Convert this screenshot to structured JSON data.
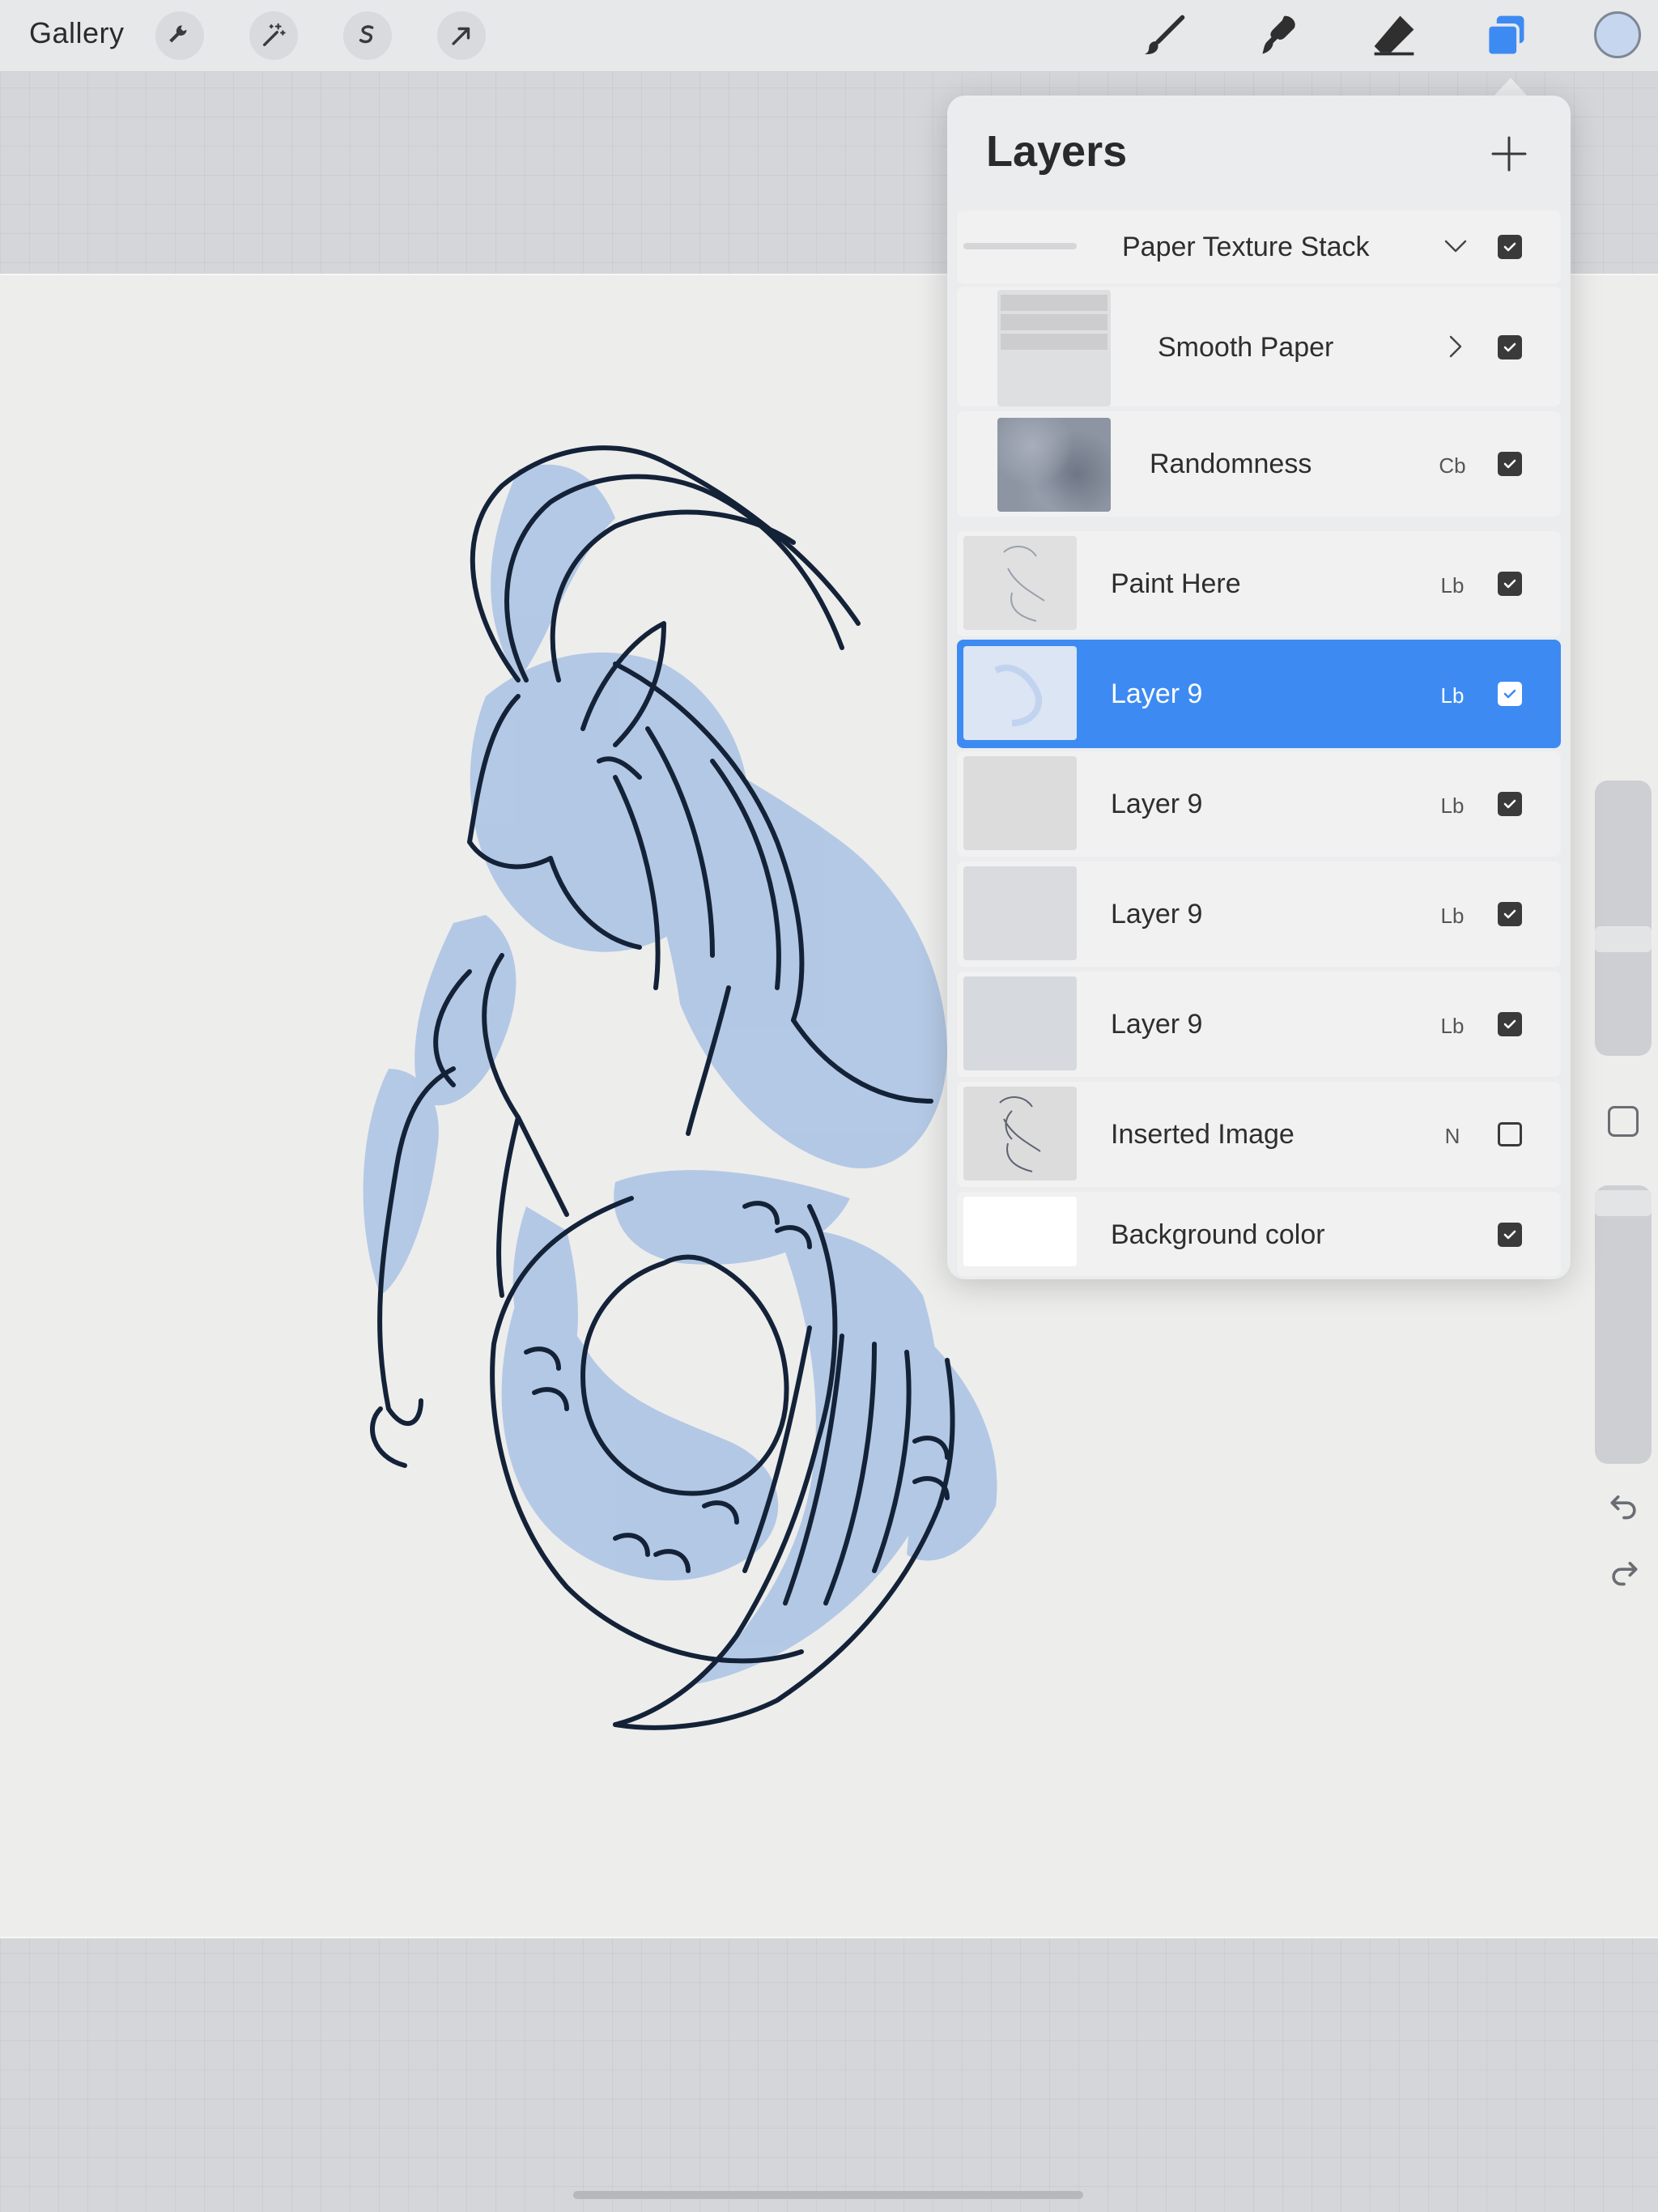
{
  "toolbar": {
    "gallery_label": "Gallery",
    "left_tools": [
      "wrench-icon",
      "magic-wand-icon",
      "selection-icon",
      "transform-arrow-icon"
    ],
    "right_tools": [
      "brush-icon",
      "smudge-icon",
      "eraser-icon",
      "layers-icon"
    ],
    "active_tool": "layers-icon",
    "color_swatch": "#c6d6ee"
  },
  "layers_panel": {
    "title": "Layers",
    "add_icon": "plus-icon",
    "rows": [
      {
        "name": "Paper Texture Stack",
        "blend": "",
        "visible": true,
        "type": "group-expanded"
      },
      {
        "name": "Smooth Paper",
        "blend": "",
        "visible": true,
        "type": "group-collapsed"
      },
      {
        "name": "Randomness",
        "blend": "Cb",
        "visible": true,
        "type": "layer"
      },
      {
        "name": "Paint Here",
        "blend": "Lb",
        "visible": true,
        "type": "layer"
      },
      {
        "name": "Layer 9",
        "blend": "Lb",
        "visible": true,
        "type": "layer",
        "selected": true
      },
      {
        "name": "Layer 9",
        "blend": "Lb",
        "visible": true,
        "type": "layer"
      },
      {
        "name": "Layer 9",
        "blend": "Lb",
        "visible": true,
        "type": "layer"
      },
      {
        "name": "Layer 9",
        "blend": "Lb",
        "visible": true,
        "type": "layer"
      },
      {
        "name": "Inserted Image",
        "blend": "N",
        "visible": false,
        "type": "layer"
      },
      {
        "name": "Background color",
        "blend": "",
        "visible": true,
        "type": "background"
      }
    ]
  },
  "colors": {
    "accent": "#3d8bf2",
    "ink": "#142238",
    "wash": "#a9c2e4"
  }
}
